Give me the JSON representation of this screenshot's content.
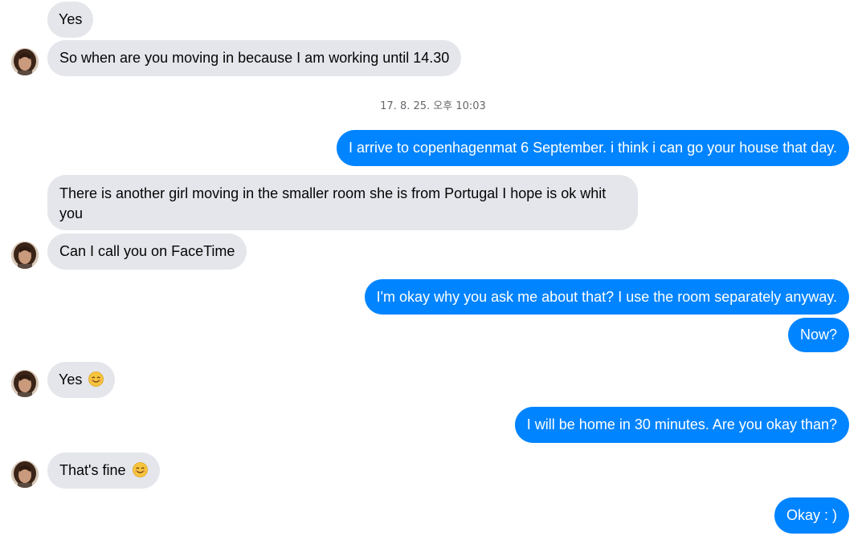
{
  "timestamp": "17. 8. 25. 오후 10:03",
  "messages": {
    "m1": "Yes",
    "m2": "So when are you moving in because I am working until 14.30",
    "m3": "I arrive to copenhagenmat 6 September. i think i can go your house that day.",
    "m4": "There is another girl moving in the smaller room she is from Portugal I hope is ok whit you",
    "m5": "Can I call you on FaceTime",
    "m6": "I'm okay why you ask me about that? I use the room separately anyway.",
    "m7": "Now?",
    "m8": "Yes",
    "m9": "I will be home in 30 minutes. Are you okay than?",
    "m10": "That's fine",
    "m11": "Okay : )"
  },
  "icons": {
    "avatar": "contact-avatar",
    "emoji": "smiling-face-emoji"
  },
  "colors": {
    "incoming_bubble": "#e4e6eb",
    "outgoing_bubble": "#0084ff",
    "timestamp_text": "#65676b"
  }
}
